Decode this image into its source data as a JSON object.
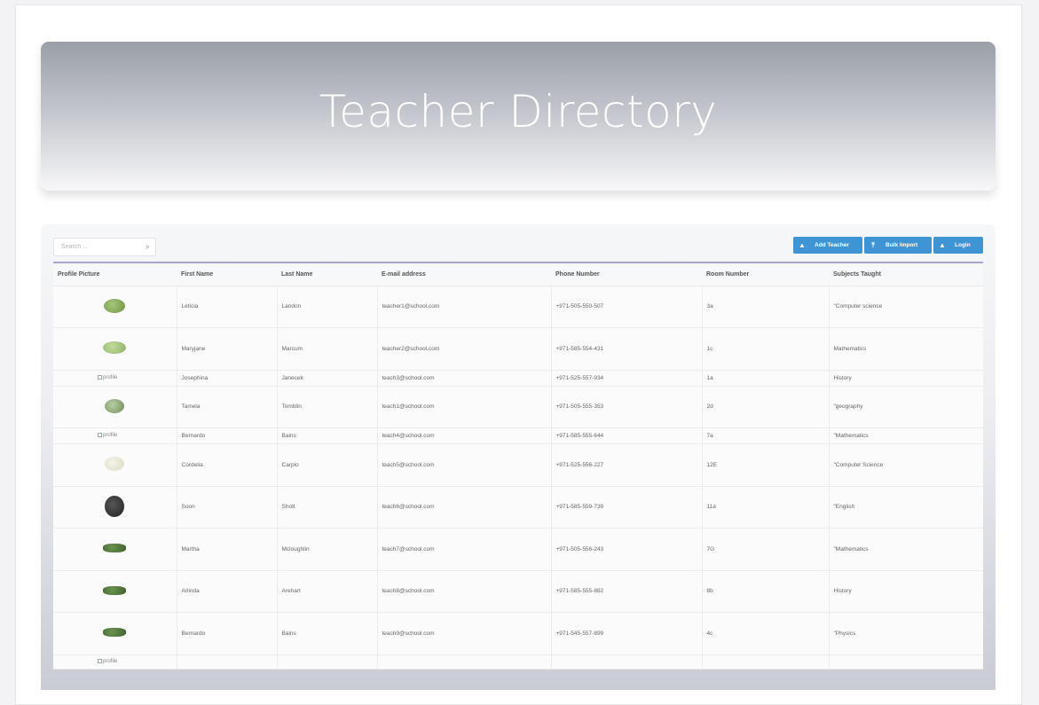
{
  "header": {
    "title": "Teacher Directory"
  },
  "search": {
    "placeholder": "Search ..."
  },
  "toolbar": {
    "add_label": "Add Teacher",
    "bulk_label": "Bulk Import",
    "login_label": "Login"
  },
  "icons": {
    "search": "search-icon",
    "user": "user-icon",
    "upload": "upload-icon"
  },
  "colors": {
    "accent": "#3f95d4",
    "header_dark": "#9a9fa8",
    "table_border": "#a9a4d8"
  },
  "table": {
    "columns": [
      "Profile Picture",
      "First Name",
      "Last Name",
      "E-mail address",
      "Phone Number",
      "Room Number",
      "Subjects Taught"
    ],
    "broken_image_alt": "profile",
    "rows": [
      {
        "first": "Leticia",
        "last": "Landon",
        "email": "teacher1@school.com",
        "phone": "+971-505-550-507",
        "room": "3a",
        "subjects": "\"Computer science"
      },
      {
        "first": "Maryjane",
        "last": "Marcum",
        "email": "teacher2@school.com",
        "phone": "+971-585-554-431",
        "room": "1c",
        "subjects": "Mathematics"
      },
      {
        "first": "Josephina",
        "last": "Janecek",
        "email": "teach3@school.com",
        "phone": "+971-525-557-934",
        "room": "1a",
        "subjects": "History"
      },
      {
        "first": "Tamela",
        "last": "Tomblin",
        "email": "teach1@school.com",
        "phone": "+971-505-555-353",
        "room": "2d",
        "subjects": "\"geography"
      },
      {
        "first": "Bernardo",
        "last": "Bains",
        "email": "teach4@school.com",
        "phone": "+971-585-555-644",
        "room": "7a",
        "subjects": "\"Mathematics"
      },
      {
        "first": "Cordelia",
        "last": "Carpio",
        "email": "teach5@school.com",
        "phone": "+971-525-556-227",
        "room": "12E",
        "subjects": "\"Computer Science"
      },
      {
        "first": "Soon",
        "last": "Shott",
        "email": "teach6@school.com",
        "phone": "+971-585-559-739",
        "room": "11a",
        "subjects": "\"English"
      },
      {
        "first": "Martha",
        "last": "Mcloughlin",
        "email": "teach7@school.com",
        "phone": "+971-505-556-243",
        "room": "7G",
        "subjects": "\"Mathematics"
      },
      {
        "first": "Arlinda",
        "last": "Arehart",
        "email": "teach8@school.com",
        "phone": "+971-585-555-882",
        "room": "8b",
        "subjects": "History"
      },
      {
        "first": "Bernardo",
        "last": "Bains",
        "email": "teach9@school.com",
        "phone": "+971-545-557-899",
        "room": "4c",
        "subjects": "\"Physics"
      }
    ]
  }
}
